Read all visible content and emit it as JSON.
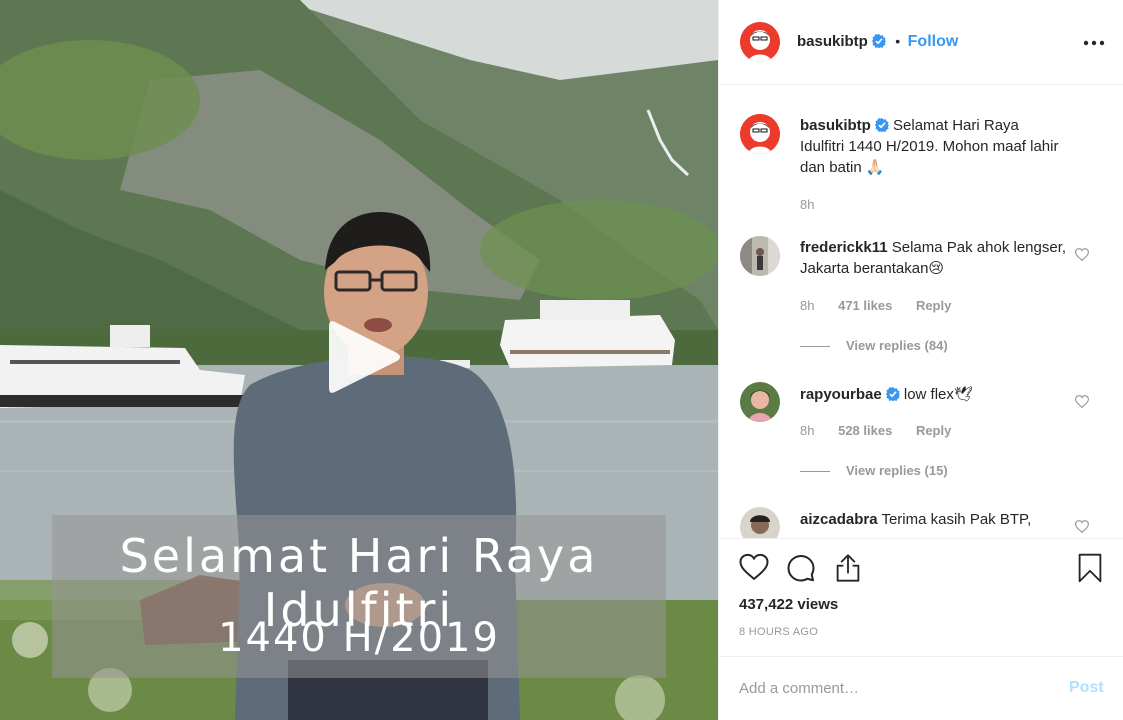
{
  "post": {
    "caption_overlay_line1": "Selamat Hari Raya Idulfitri",
    "caption_overlay_line2": "1440 H/2019"
  },
  "header": {
    "username": "basukibtp",
    "separator": "•",
    "follow_label": "Follow"
  },
  "comments": [
    {
      "username": "basukibtp",
      "text": "Selamat Hari Raya Idulfitri 1440 H/2019. Mohon maaf lahir dan batin",
      "emoji": "🙏🏻",
      "time": "8h",
      "verified": true
    },
    {
      "username": "frederickk11",
      "text": "Selama Pak ahok lengser, Jakarta berantakan",
      "emoji": "😢",
      "time": "8h",
      "likes": "471 likes",
      "reply_label": "Reply",
      "view_replies": "View replies (84)"
    },
    {
      "username": "rapyourbae",
      "text": "low flex",
      "emoji": "🕊",
      "time": "8h",
      "likes": "528 likes",
      "reply_label": "Reply",
      "view_replies": "View replies (15)",
      "verified": true
    },
    {
      "username": "aizcadabra",
      "text": "Terima kasih Pak BTP,"
    }
  ],
  "stats": {
    "views": "437,422 views",
    "time_ago": "8 HOURS AGO"
  },
  "add_comment": {
    "placeholder": "Add a comment…",
    "post_label": "Post"
  },
  "icons": [
    "play-icon",
    "more-icon",
    "verified-badge-icon",
    "heart-icon",
    "comment-icon",
    "share-icon",
    "bookmark-icon"
  ],
  "colors": {
    "accent": "#3897f0",
    "muted": "#999999",
    "post_disabled": "#b2dffc",
    "verified": "#3897f0"
  }
}
